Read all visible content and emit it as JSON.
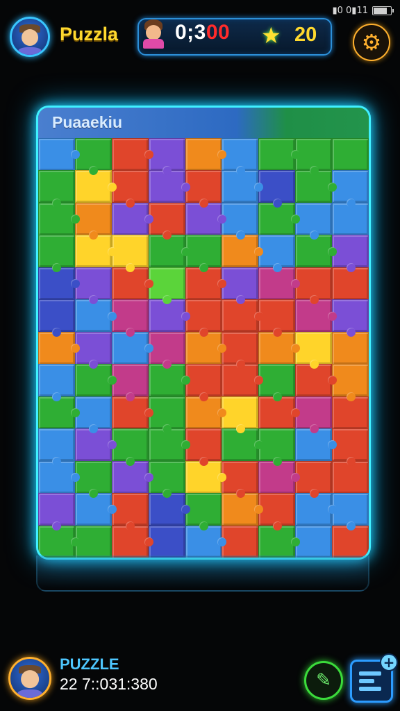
{
  "status_bar": {
    "text": "▮0 0▮11"
  },
  "header": {
    "title": "Puzzla",
    "timer_white": "0;3",
    "timer_red": "00",
    "score": "20",
    "icons": {
      "star": "star-icon",
      "gear": "gear-icon"
    }
  },
  "board": {
    "title": "Puaaekiu",
    "rows": 12,
    "cols": 9,
    "palette": {
      "R": "#e0452b",
      "O": "#f08a1c",
      "Y": "#ffd42a",
      "G": "#2fae34",
      "L": "#5bd43a",
      "B": "#3a8fe6",
      "P": "#7b4fd6",
      "M": "#c23b8a",
      "N": "#3b4fc7"
    },
    "colors": [
      "BGRPOBGGG",
      "GYRPRBNGB",
      "GOPRPBGBB",
      "GYYGGOBGP",
      "NPRLRPMRR",
      "NBMPRRRMP",
      "OPBMOROYO",
      "BGMGRRGRO",
      "GBRGOYRMR",
      "BPGGRGGBR",
      "BGPGYRMRR",
      "PBRNGORBB",
      "GGRNBRGBR"
    ]
  },
  "footer": {
    "label": "PUZZLE",
    "value": "22 7::031:380",
    "icons": {
      "pencil": "pencil-icon",
      "menu": "list-add-icon"
    }
  }
}
